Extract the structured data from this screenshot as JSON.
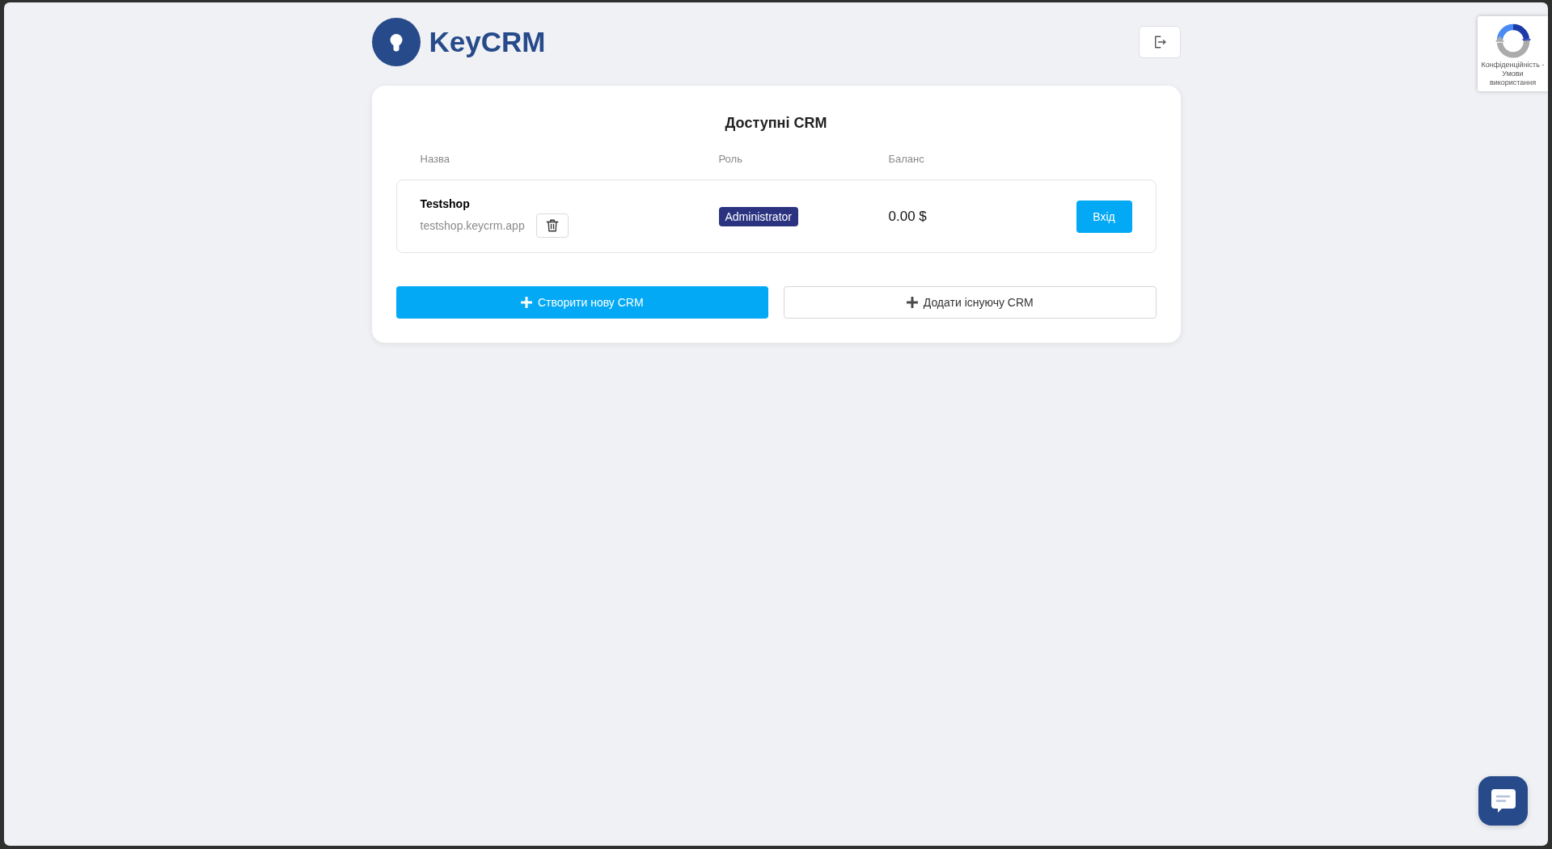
{
  "header": {
    "logo_text": "KeyCRM"
  },
  "card": {
    "title": "Доступні CRM",
    "columns": [
      "Назва",
      "Роль",
      "Баланс"
    ],
    "rows": [
      {
        "name": "Testshop",
        "domain": "testshop.keycrm.app",
        "role": "Administrator",
        "balance": "0.00 $",
        "action": "Вхід"
      }
    ],
    "buttons": [
      {
        "label": "Створити нову CRM",
        "kind": "primary"
      },
      {
        "label": "Додати існуючу CRM",
        "kind": "secondary"
      }
    ]
  },
  "privacy_badge": {
    "text": "Конфіденційність - Умови використання"
  }
}
